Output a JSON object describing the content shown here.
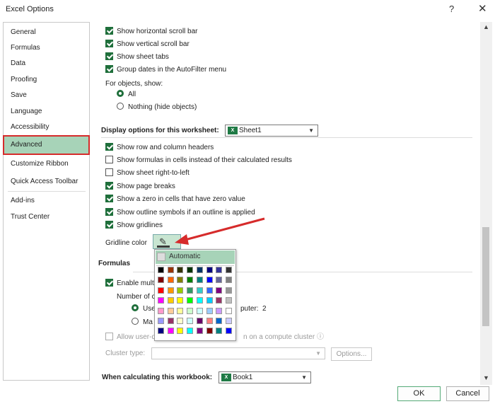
{
  "window": {
    "title": "Excel Options",
    "help_glyph": "?",
    "close_glyph": "✕"
  },
  "sidebar": {
    "items": [
      {
        "label": "General"
      },
      {
        "label": "Formulas"
      },
      {
        "label": "Data"
      },
      {
        "label": "Proofing"
      },
      {
        "label": "Save"
      },
      {
        "label": "Language"
      },
      {
        "label": "Accessibility"
      },
      {
        "label": "Advanced",
        "selected": true
      },
      {
        "label": "Customize Ribbon"
      },
      {
        "label": "Quick Access Toolbar"
      },
      {
        "label": "Add-ins"
      },
      {
        "label": "Trust Center"
      }
    ]
  },
  "workbook_opts": {
    "h_scroll": "Show horizontal scroll bar",
    "v_scroll": "Show vertical scroll bar",
    "sheet_tabs": "Show sheet tabs",
    "group_dates": "Group dates in the AutoFilter menu",
    "for_objects": "For objects, show:",
    "all": "All",
    "nothing": "Nothing (hide objects)"
  },
  "worksheet": {
    "heading": "Display options for this worksheet:",
    "sheet": "Sheet1",
    "row_col_headers": "Show row and column headers",
    "formulas_cells": "Show formulas in cells instead of their calculated results",
    "right_to_left": "Show sheet right-to-left",
    "page_breaks": "Show page breaks",
    "zero": "Show a zero in cells that have zero value",
    "outline": "Show outline symbols if an outline is applied",
    "gridlines": "Show gridlines",
    "gridline_color": "Gridline color"
  },
  "palette": {
    "automatic": "Automatic"
  },
  "formulas": {
    "heading": "Formulas",
    "enable_multi": "Enable mult",
    "number_of": "Number of c",
    "use_all": "Use",
    "use_all_tail": "puter:",
    "threads": "2",
    "manual": "Ma",
    "allow_user": "Allow user-d",
    "allow_user_tail": "n on a compute cluster",
    "cluster_type": "Cluster type:",
    "options_btn": "Options..."
  },
  "calc_workbook": {
    "heading": "When calculating this workbook:",
    "book": "Book1"
  },
  "buttons": {
    "ok": "OK",
    "cancel": "Cancel"
  },
  "colors": {
    "accent": "#1f6f3b",
    "selection": "#a7d3b8",
    "highlight_red": "#d62b2b"
  }
}
